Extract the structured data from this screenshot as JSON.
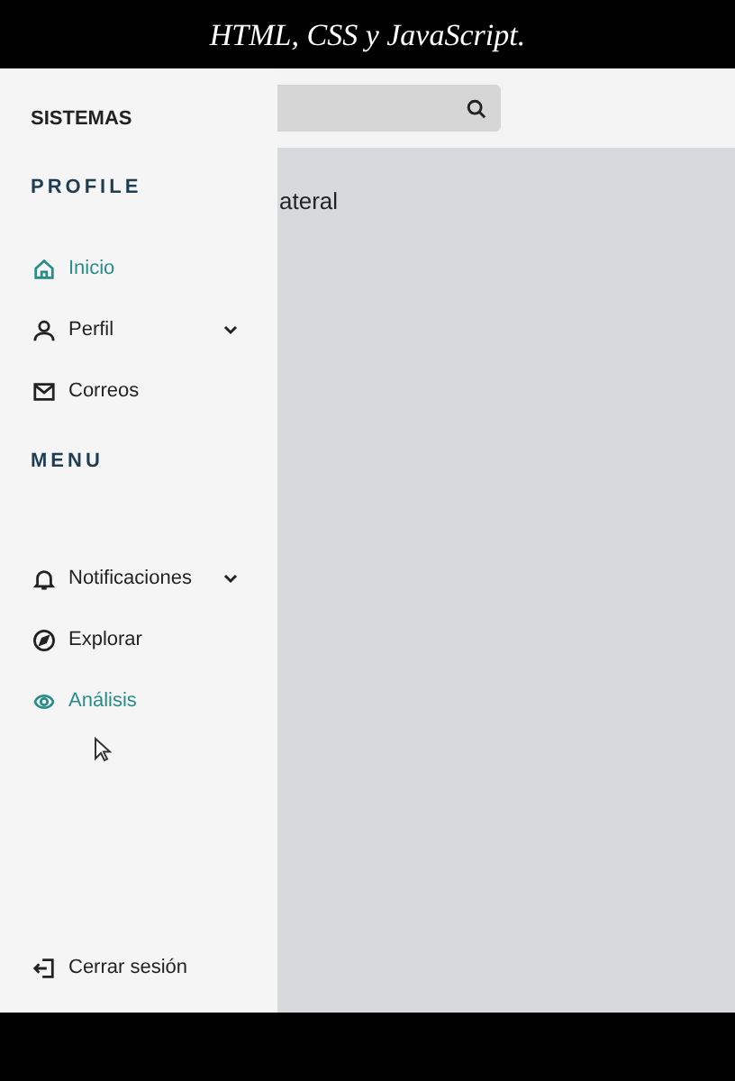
{
  "caption": "HTML, CSS y JavaScript.",
  "sidebar": {
    "title": "SISTEMAS",
    "sections": [
      {
        "heading": "PROFILE",
        "items": [
          {
            "label": "Inicio",
            "selected": true,
            "has_submenu": false
          },
          {
            "label": "Perfil",
            "selected": false,
            "has_submenu": true
          },
          {
            "label": "Correos",
            "selected": false,
            "has_submenu": false
          }
        ]
      },
      {
        "heading": "MENU",
        "items": [
          {
            "label": "Notificaciones",
            "selected": false,
            "has_submenu": true
          },
          {
            "label": "Explorar",
            "selected": false,
            "has_submenu": false
          },
          {
            "label": "Análisis",
            "selected": true,
            "has_submenu": false
          }
        ]
      }
    ],
    "footer": {
      "label": "Cerrar sesión"
    }
  },
  "main": {
    "heading": "ateral"
  }
}
